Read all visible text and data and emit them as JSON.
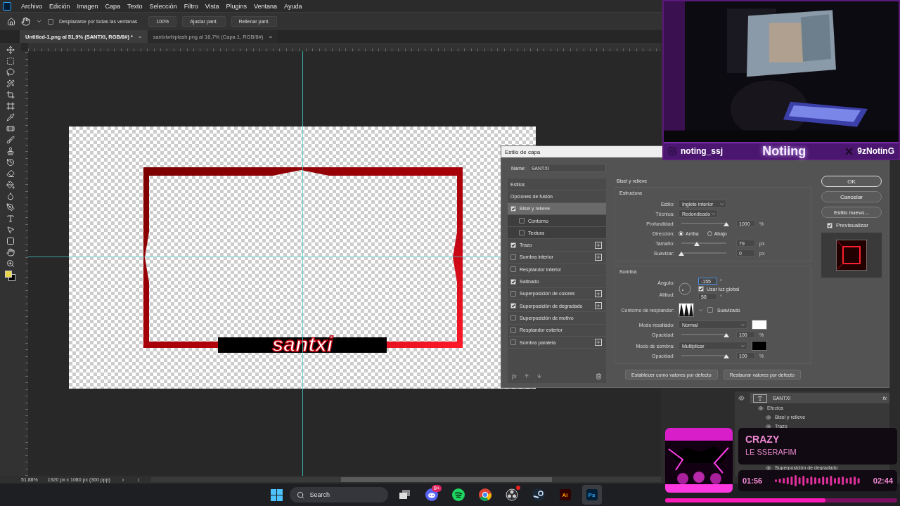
{
  "menu_bar": {
    "items": [
      "Archivo",
      "Edición",
      "Imagen",
      "Capa",
      "Texto",
      "Selección",
      "Filtro",
      "Vista",
      "Plugins",
      "Ventana",
      "Ayuda"
    ]
  },
  "options_bar": {
    "scroll_all": {
      "label": "Desplazarse por todas las ventanas",
      "checked": false
    },
    "zoom_button": "100%",
    "buttons": [
      "Ajustar pant.",
      "Rellenar pant."
    ]
  },
  "document_tabs": [
    {
      "label": "Untitled-1.png al 51,9% (SANTXI, RGB/8#) *",
      "close": "×",
      "selected": true
    },
    {
      "label": "santxiwhiplash.png al 16,7% (Capa 1, RGB/8#)",
      "close": "×",
      "selected": false
    }
  ],
  "canvas": {
    "logo_text": "santxi"
  },
  "layer_style_dialog": {
    "title": "Estilo de capa",
    "name_label": "Name:",
    "name_value": "SANTXI",
    "styles": [
      {
        "label": "Estilos",
        "kind": "heading"
      },
      {
        "label": "Opciones de fusión",
        "kind": "heading"
      },
      {
        "label": "Bisel y relieve",
        "kind": "effect",
        "checked": true,
        "selected": true,
        "addable": false,
        "children": [
          {
            "label": "Contorno",
            "checked": false
          },
          {
            "label": "Textura",
            "checked": false
          }
        ]
      },
      {
        "label": "Trazo",
        "kind": "effect",
        "checked": true,
        "selected": false,
        "addable": true
      },
      {
        "label": "Sombra interior",
        "kind": "effect",
        "checked": false,
        "selected": false,
        "addable": true
      },
      {
        "label": "Resplandor interior",
        "kind": "effect",
        "checked": false,
        "selected": false,
        "addable": false
      },
      {
        "label": "Satinado",
        "kind": "effect",
        "checked": true,
        "selected": false,
        "addable": false
      },
      {
        "label": "Superposición de colores",
        "kind": "effect",
        "checked": false,
        "selected": false,
        "addable": true
      },
      {
        "label": "Superposición de degradado",
        "kind": "effect",
        "checked": true,
        "selected": false,
        "addable": true
      },
      {
        "label": "Superposición de motivo",
        "kind": "effect",
        "checked": false,
        "selected": false,
        "addable": false
      },
      {
        "label": "Resplandor exterior",
        "kind": "effect",
        "checked": false,
        "selected": false,
        "addable": false
      },
      {
        "label": "Sombra paralela",
        "kind": "effect",
        "checked": false,
        "selected": false,
        "addable": true
      }
    ],
    "settings": {
      "title": "Bisel y relieve",
      "structure": {
        "title": "Estructura",
        "style": {
          "label": "Estilo:",
          "value": "Inglete interior"
        },
        "technique": {
          "label": "Técnica:",
          "value": "Redondeado"
        },
        "depth": {
          "label": "Profundidad:",
          "level": 1,
          "value": "1000",
          "unit": "%"
        },
        "direction": {
          "label": "Dirección:",
          "options": [
            {
              "label": "Arriba",
              "selected": true
            },
            {
              "label": "Abajo",
              "selected": false
            }
          ]
        },
        "size": {
          "label": "Tamaño:",
          "level": 0.35,
          "value": "79",
          "unit": "px"
        },
        "soften": {
          "label": "Suavizar:",
          "level": 0,
          "value": "0",
          "unit": "px"
        }
      },
      "shading": {
        "title": "Sombra",
        "angle": {
          "label": "Ángulo:",
          "value": "-155",
          "unit": "°"
        },
        "global_light": {
          "label": "Usar luz global",
          "checked": true
        },
        "altitude": {
          "label": "Altitud:",
          "value": "58",
          "unit": "°"
        },
        "gloss_contour": {
          "label": "Contorno de resplandor:"
        },
        "anti_aliased": {
          "label": "Suavizado",
          "checked": false
        },
        "highlight_mode": {
          "label": "Modo resaltado:",
          "value": "Normal",
          "color": "#ffffff"
        },
        "highlight_opacity": {
          "label": "Opacidad:",
          "level": 1,
          "value": "100",
          "unit": "%"
        },
        "shadow_mode": {
          "label": "Modo de sombra:",
          "value": "Multiplicar",
          "color": "#000000"
        },
        "shadow_opacity": {
          "label": "Opacidad:",
          "level": 1,
          "value": "100",
          "unit": "%"
        }
      },
      "default_buttons": [
        "Establecer como valores por defecto",
        "Restaurar valores por defecto"
      ]
    },
    "action_buttons": [
      "OK",
      "Cancelar",
      "Estilo nuevo..."
    ],
    "preview": {
      "label": "Previsualizar",
      "checked": true
    },
    "footer_fx": "fx"
  },
  "layers_panel": {
    "layer": {
      "name": "SANTXI",
      "fx": "fx"
    },
    "effects_label": "Efectos",
    "effects": [
      "Bisel y relieve",
      "Trazo"
    ],
    "partial_effect": "Superposición de degradado"
  },
  "status_bar": {
    "zoom": "51.88%",
    "document_size": "1920 px x 1080 px (300 ppp)"
  },
  "stream_overlay": {
    "instagram": "noting_ssj",
    "name": "Notiing",
    "x_handle": "9zNotinG"
  },
  "now_playing": {
    "title": "CRAZY",
    "artist": "LE SSERAFIM",
    "elapsed": "01:56",
    "total": "02:44",
    "level": 0.69
  },
  "taskbar": {
    "search_placeholder": "Search",
    "apps": [
      {
        "kind": "taskview",
        "selected": false
      },
      {
        "kind": "discord",
        "badge": "9+",
        "selected": false
      },
      {
        "kind": "spotify",
        "selected": false
      },
      {
        "kind": "chrome",
        "selected": false
      },
      {
        "kind": "obs",
        "selected": false
      },
      {
        "kind": "steam",
        "selected": false
      },
      {
        "kind": "illustrator",
        "label": "Ai",
        "selected": false
      },
      {
        "kind": "photoshop",
        "label": "Ps",
        "selected": true
      }
    ]
  }
}
